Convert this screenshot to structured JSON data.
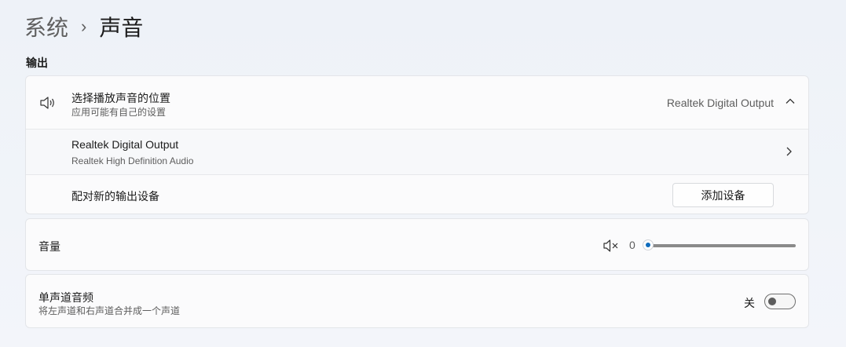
{
  "breadcrumb": {
    "parent": "系统",
    "separator": "›",
    "current": "声音"
  },
  "output": {
    "section_title": "输出",
    "header": {
      "title": "选择播放声音的位置",
      "subtitle": "应用可能有自己的设置",
      "selected_device": "Realtek Digital Output",
      "icon": "speaker-icon",
      "expanded": true
    },
    "device": {
      "name": "Realtek Digital Output",
      "description": "Realtek High Definition Audio"
    },
    "pair": {
      "label": "配对新的输出设备",
      "button_label": "添加设备"
    }
  },
  "volume": {
    "label": "音量",
    "value": "0",
    "muted": true,
    "level_percent": 0,
    "icon": "speaker-muted-icon"
  },
  "mono_audio": {
    "title": "单声道音频",
    "subtitle": "将左声道和右声道合并成一个声道",
    "state_label": "关",
    "enabled": false
  },
  "colors": {
    "accent": "#0f6cbd",
    "card_background": "#fbfbfc",
    "page_background": "#eef2f8"
  }
}
